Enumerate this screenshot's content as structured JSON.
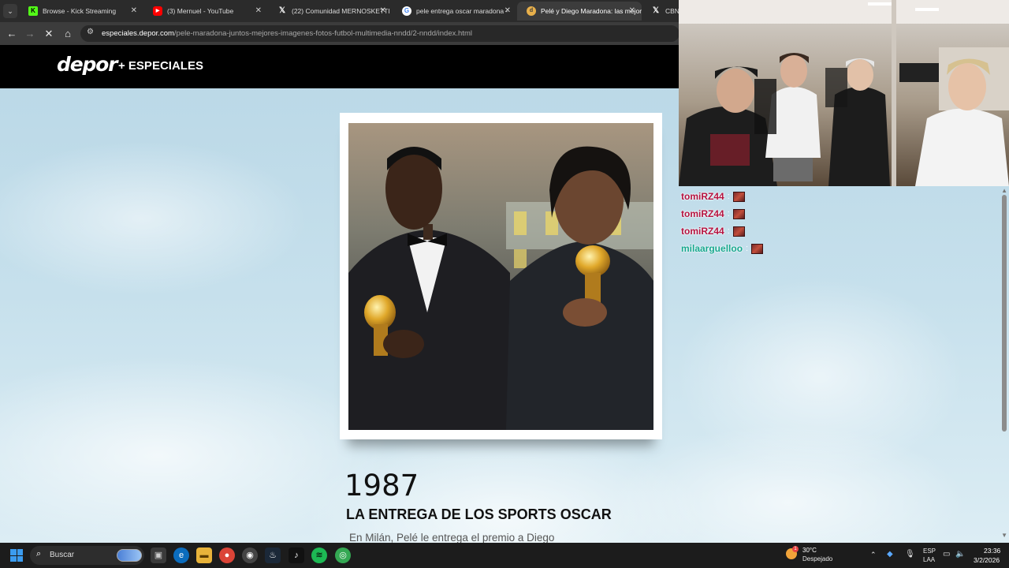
{
  "browser": {
    "tabs": [
      {
        "title": "Browse - Kick Streaming",
        "icon": "kick-icon",
        "active": false
      },
      {
        "title": "(3) Mernuel - YouTube",
        "icon": "youtube-icon",
        "active": false
      },
      {
        "title": "(22) Comunidad MERNOSKETTI",
        "icon": "x-icon",
        "active": false
      },
      {
        "title": "pele entrega oscar maradona -",
        "icon": "google-icon",
        "active": false
      },
      {
        "title": "Pelé y Diego Maradona: las mejores",
        "icon": "depor-icon",
        "active": true
      },
      {
        "title": "CBNJ",
        "icon": "x-icon",
        "active": false
      }
    ],
    "url_host": "especiales.depor.com",
    "url_path": "/pele-maradona-juntos-mejores-imagenes-fotos-futbol-multimedia-nndd/2-nndd/index.html"
  },
  "site": {
    "logo": "depor",
    "section": "+ ESPECIALES"
  },
  "article": {
    "year": "1987",
    "headline": "LA ENTREGA DE LOS SPORTS OSCAR",
    "body": "En Milán, Pelé le entrega el premio a Diego"
  },
  "chat": [
    {
      "user": "tomiRZ44",
      "color": "#b5123f",
      "sep": ":"
    },
    {
      "user": "tomiRZ44",
      "color": "#b5123f",
      "sep": ":"
    },
    {
      "user": "tomiRZ44",
      "color": "#b5123f",
      "sep": ":"
    },
    {
      "user": "milaarguelloo",
      "color": "#17a88f",
      "sep": ":"
    }
  ],
  "taskbar": {
    "search_label": "Buscar",
    "weather_temp": "30°C",
    "weather_desc": "Despejado",
    "lang_1": "ESP",
    "lang_2": "LAA",
    "time": "23:36",
    "date": "3/2/2026",
    "weather_badge": "1"
  },
  "colors": {
    "page_header": "#000000",
    "sky": "#c6e0ec",
    "taskbar": "#1c1c1c"
  }
}
